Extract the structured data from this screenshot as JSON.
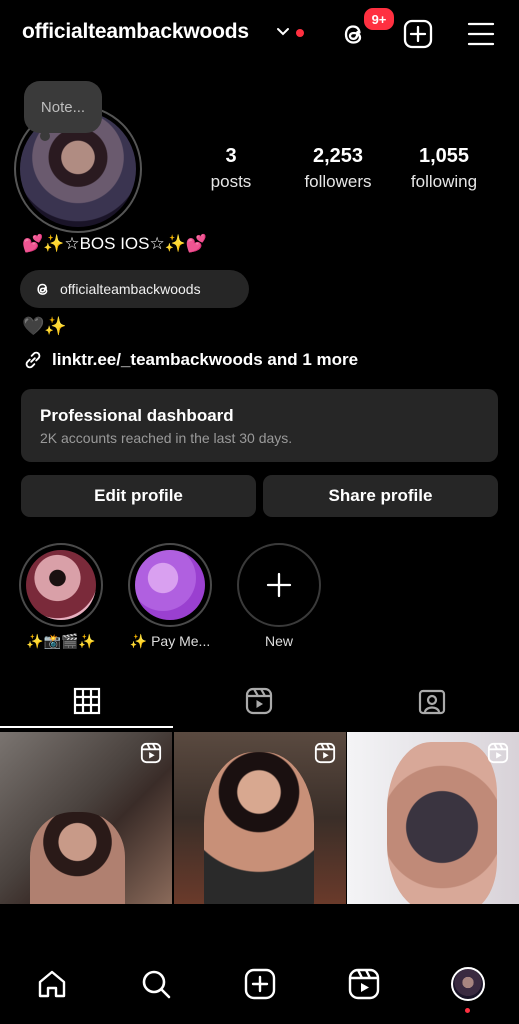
{
  "header": {
    "username": "officialteambackwoods",
    "threads_badge": "9+"
  },
  "profile": {
    "note_placeholder": "Note...",
    "stats": [
      {
        "value": "3",
        "label": "posts"
      },
      {
        "value": "2,253",
        "label": "followers"
      },
      {
        "value": "1,055",
        "label": "following"
      }
    ],
    "display_name": "💕✨☆BOS IOS☆✨💕",
    "threads_handle": "officialteambackwoods",
    "bio_line": "🖤✨",
    "link_text": "linktr.ee/_teambackwoods and 1 more"
  },
  "dashboard": {
    "title": "Professional dashboard",
    "subtitle": "2K accounts reached in the last 30 days."
  },
  "buttons": {
    "edit_profile": "Edit profile",
    "share_profile": "Share profile"
  },
  "highlights": [
    {
      "label": "✨📸🎬✨"
    },
    {
      "label": "✨ Pay Me..."
    },
    {
      "label": "New"
    }
  ],
  "tabs": [
    "grid-icon",
    "reels-icon",
    "tagged-icon"
  ],
  "nav": [
    "home-icon",
    "search-icon",
    "create-icon",
    "reels-icon",
    "profile-avatar"
  ],
  "colors": {
    "background": "#000000",
    "surface": "#262626",
    "accent_red": "#ff3040"
  }
}
